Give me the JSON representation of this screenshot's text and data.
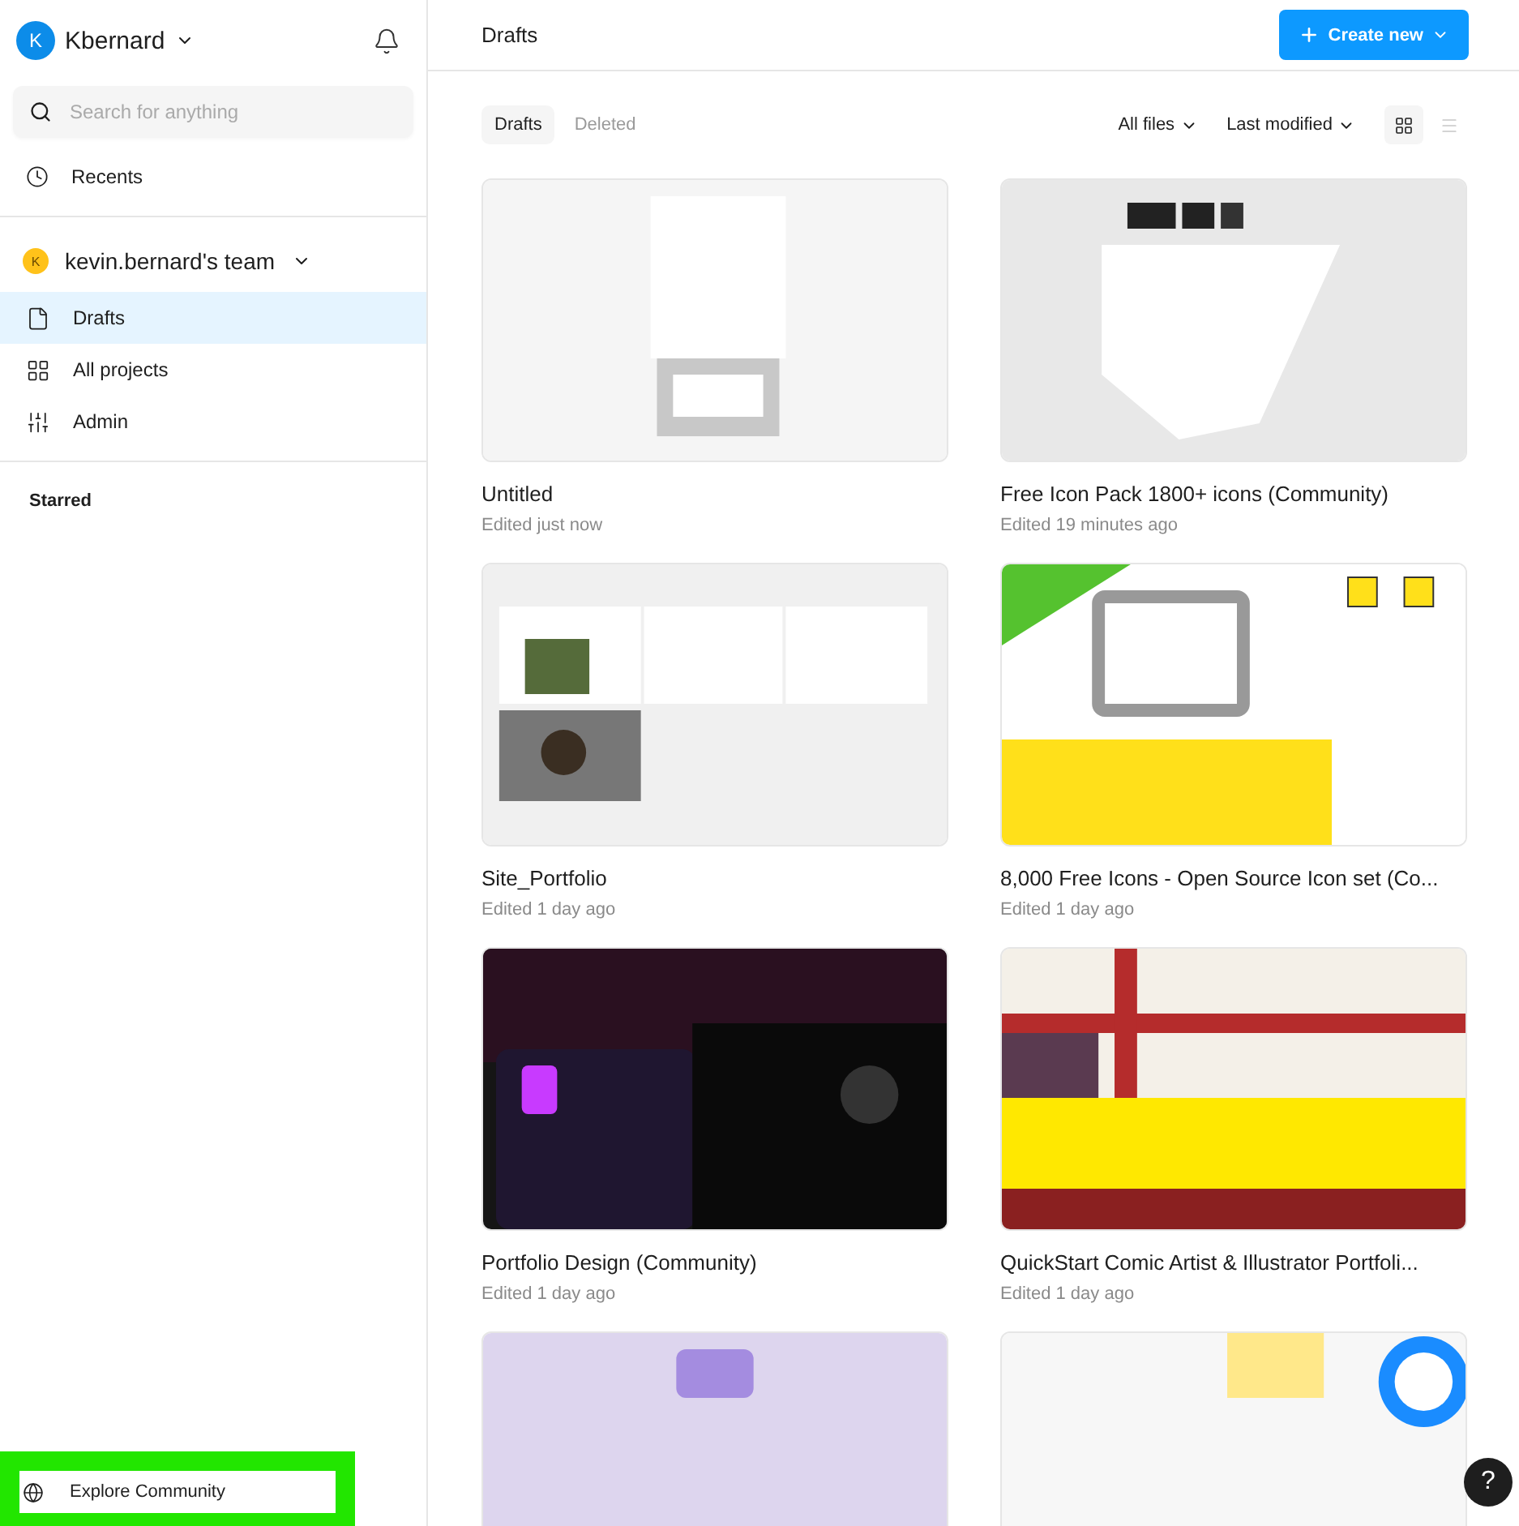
{
  "account": {
    "initial": "K",
    "name": "Kbernard"
  },
  "search": {
    "placeholder": "Search for anything"
  },
  "recents": {
    "label": "Recents"
  },
  "team": {
    "initial": "K",
    "name": "kevin.bernard's team"
  },
  "nav": [
    {
      "kind": "file",
      "label": "Drafts",
      "selected": true
    },
    {
      "kind": "grid",
      "label": "All projects",
      "selected": false
    },
    {
      "kind": "sliders",
      "label": "Admin",
      "selected": false
    }
  ],
  "starred": {
    "heading": "Starred"
  },
  "explore": {
    "label": "Explore Community",
    "highlighted": true
  },
  "header": {
    "title": "Drafts",
    "create_button": "Create new"
  },
  "tabs": [
    {
      "label": "Drafts",
      "selected": true
    },
    {
      "label": "Deleted",
      "selected": false
    }
  ],
  "filters": [
    "All files",
    "Last modified"
  ],
  "views": [
    {
      "kind": "grid",
      "selected": true
    },
    {
      "kind": "list",
      "selected": false
    }
  ],
  "files": [
    {
      "title": "Untitled",
      "edited": "Edited just now",
      "thumbnail": {
        "kind": "picture"
      }
    },
    {
      "title": "Free Icon Pack 1800+ icons (Community)",
      "edited": "Edited 19 minutes ago",
      "thumbnail": {
        "kind": "picture"
      }
    },
    {
      "title": "Site_Portfolio",
      "edited": "Edited 1 day ago",
      "thumbnail": {
        "kind": "picture"
      }
    },
    {
      "title": "8,000 Free Icons - Open Source Icon set (Co...",
      "edited": "Edited 1 day ago",
      "thumbnail": {
        "kind": "picture"
      }
    },
    {
      "title": "Portfolio Design (Community)",
      "edited": "Edited 1 day ago",
      "thumbnail": {
        "kind": "picture"
      }
    },
    {
      "title": "QuickStart Comic Artist & Illustrator Portfoli...",
      "edited": "Edited 1 day ago",
      "thumbnail": {
        "kind": "picture"
      }
    },
    {
      "thumbnail": {
        "kind": "picture"
      }
    },
    {
      "thumbnail": {
        "kind": "picture"
      }
    }
  ],
  "help_button": "?"
}
